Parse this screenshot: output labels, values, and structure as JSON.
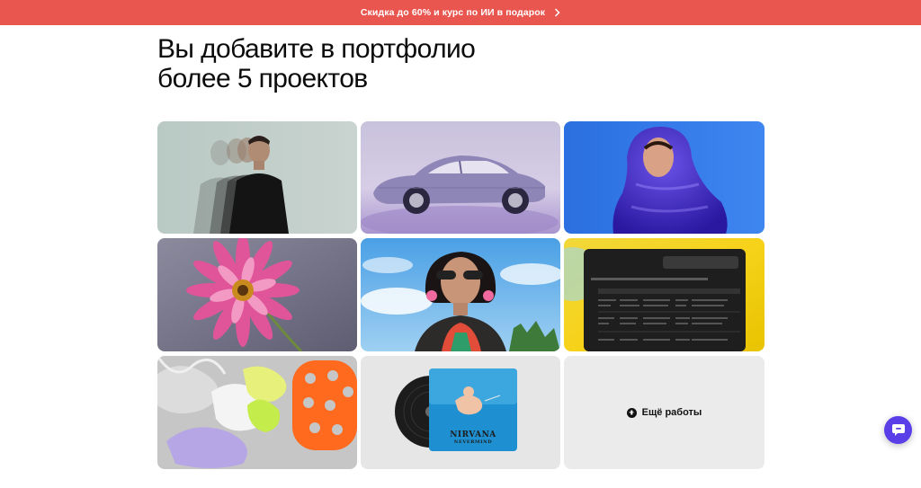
{
  "promo": {
    "text": "Скидка до 60% и курс по ИИ в подарок"
  },
  "headline": {
    "line1": "Вы добавите в портфолио",
    "line2": "более 5 проектов"
  },
  "portfolio": {
    "more_label": "Ещё работы",
    "album_title": "NIRVANA",
    "album_subtitle": "NEVERMIND"
  },
  "colors": {
    "promo": "#e8564f",
    "chat": "#5a3ee8",
    "more_tile": "#ebebeb"
  }
}
